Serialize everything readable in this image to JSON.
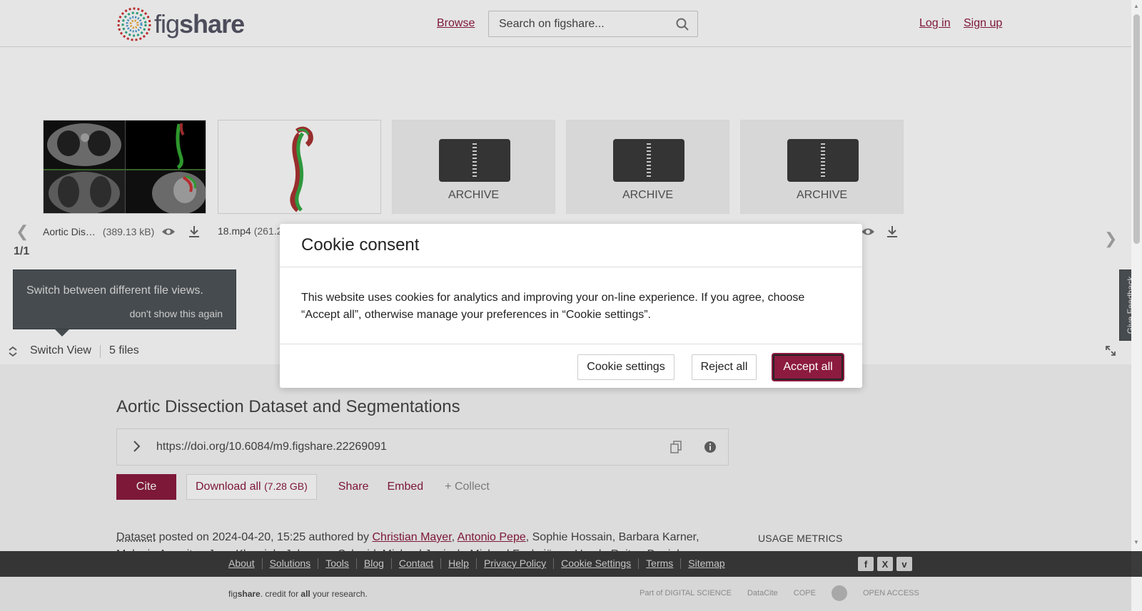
{
  "header": {
    "logo_text_light": "fig",
    "logo_text_bold": "share",
    "browse": "Browse",
    "search_placeholder": "Search on figshare...",
    "login": "Log in",
    "signup": "Sign up"
  },
  "viewer": {
    "counter": "1/1",
    "files": [
      {
        "name": "Aortic Dis…",
        "size": "(389.13 kB)"
      },
      {
        "name": "18.mp4",
        "size": "(261.2"
      },
      {
        "archive_label": "ARCHIVE"
      },
      {
        "archive_label": "ARCHIVE"
      },
      {
        "archive_label": "ARCHIVE"
      }
    ],
    "tooltip_text": "Switch between different file views.",
    "tooltip_dismiss": "don't show this again",
    "switch_view": "Switch View",
    "file_count": "5 files",
    "feedback": "Give Feedback"
  },
  "item": {
    "title": "Aortic Dissection Dataset and Segmentations",
    "doi": "https://doi.org/10.6084/m9.figshare.22269091",
    "cite": "Cite",
    "download_all": "Download all",
    "download_size": "(7.28 GB)",
    "share": "Share",
    "embed": "Embed",
    "collect": "+ Collect",
    "item_type": "Dataset",
    "posted_text": " posted on 2024-04-20, 15:25 authored by ",
    "author1": "Christian Mayer",
    "author2": "Antonio Pepe",
    "other_authors": ", Sophie Hossain, Barbara Karner,",
    "authors_line2": "Melanie Arnreiter, Jens Kleesiek, Johannes Schmid, Michael Janisch, Michael Fuchsjäger, Ursula Reiter, Daniel",
    "usage_metrics": "USAGE METRICS"
  },
  "footer": {
    "links": [
      "About",
      "Solutions",
      "Tools",
      "Blog",
      "Contact",
      "Help",
      "Privacy Policy",
      "Cookie Settings",
      "Terms",
      "Sitemap"
    ],
    "tagline_pre": "fig",
    "tagline_bold": "share",
    "tagline_mid": ". credit for ",
    "tagline_all": "all",
    "tagline_post": " your research.",
    "partner_digital_science": "Part of DIGITAL SCIENCE",
    "partner_datacite": "DataCite",
    "partner_cope": "COPE",
    "partner_open_access": "OPEN ACCESS"
  },
  "cookie": {
    "title": "Cookie consent",
    "body": "This website uses cookies for analytics and improving your on-line experience. If you agree, choose “Accept all”, otherwise manage your preferences in “Cookie settings”.",
    "settings": "Cookie settings",
    "reject": "Reject all",
    "accept": "Accept all"
  },
  "colors": {
    "brand": "#8c1b3f",
    "tooltip_bg": "#4e5458",
    "footer_bg": "#3b3b3b"
  }
}
